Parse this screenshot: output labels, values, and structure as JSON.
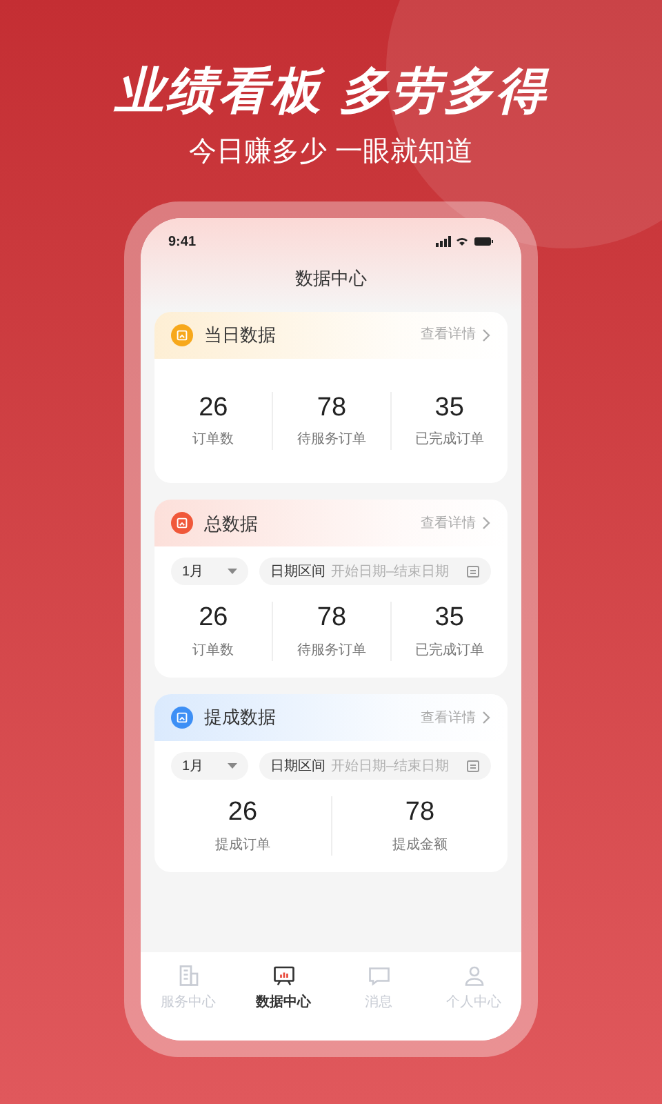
{
  "headline": "业绩看板 多劳多得",
  "subheadline": "今日赚多少 一眼就知道",
  "status_bar": {
    "time": "9:41"
  },
  "screen_title": "数据中心",
  "cards": [
    {
      "title": "当日数据",
      "color": "#f7a81b",
      "link": "查看详情",
      "stats": [
        {
          "value": "26",
          "label": "订单数"
        },
        {
          "value": "78",
          "label": "待服务订单"
        },
        {
          "value": "35",
          "label": "已完成订单"
        }
      ]
    },
    {
      "title": "总数据",
      "color": "#f0583a",
      "link": "查看详情",
      "filters": {
        "month": "1月",
        "range_label": "日期区间",
        "range_placeholder": "开始日期–结束日期"
      },
      "stats": [
        {
          "value": "26",
          "label": "订单数"
        },
        {
          "value": "78",
          "label": "待服务订单"
        },
        {
          "value": "35",
          "label": "已完成订单"
        }
      ]
    },
    {
      "title": "提成数据",
      "color": "#3d8ff5",
      "link": "查看详情",
      "filters": {
        "month": "1月",
        "range_label": "日期区间",
        "range_placeholder": "开始日期–结束日期"
      },
      "stats": [
        {
          "value": "26",
          "label": "提成订单"
        },
        {
          "value": "78",
          "label": "提成金额"
        }
      ]
    }
  ],
  "tabs": [
    {
      "label": "服务中心",
      "kind": "building",
      "selected": false
    },
    {
      "label": "数据中心",
      "kind": "board",
      "selected": true
    },
    {
      "label": "消息",
      "kind": "chat",
      "selected": false
    },
    {
      "label": "个人中心",
      "kind": "person",
      "selected": false
    }
  ]
}
